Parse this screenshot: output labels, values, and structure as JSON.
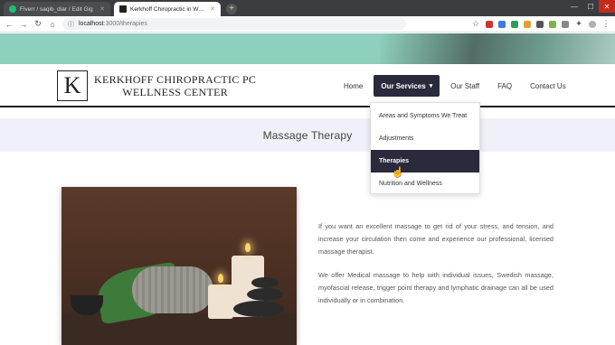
{
  "browser": {
    "tabs": [
      {
        "title": "Fiverr / saqib_diar / Edit Gig",
        "color": "#1dbf73"
      },
      {
        "title": "Kerkhoff Chiropractic in Wauke",
        "color": "#222222"
      }
    ],
    "new_tab": "+",
    "address_host": "localhost",
    "address_path": ":3000/therapies",
    "colors": {
      "tabbar": "#3a3c40"
    }
  },
  "site": {
    "logo_letter": "K",
    "name_line1": "KERKHOFF CHIROPRACTIC PC",
    "name_line2": "WELLNESS CENTER",
    "nav": {
      "home": "Home",
      "services": "Our Services",
      "staff": "Our Staff",
      "faq": "FAQ",
      "contact": "Contact Us"
    },
    "colors": {
      "accent": "#2b2a3c",
      "banner": "#8fcfbd",
      "page_bar": "#f0f0f8"
    }
  },
  "dropdown": {
    "items": [
      "Areas and Symptoms We Treat",
      "Adjustments",
      "Therapies",
      "Nutrition and Wellness"
    ],
    "active": "Therapies"
  },
  "page": {
    "title": "Massage Therapy",
    "paragraphs": [
      "If you want an excellent massage to get rid of your stress, and tension, and increase your circulation then come and experience our professional, licensed massage therapist.",
      "We offer Medical massage to help with individual issues, Swedish massage, myofascial release, trigger point therapy and lymphatic drainage can all be used individually or in combination."
    ]
  }
}
